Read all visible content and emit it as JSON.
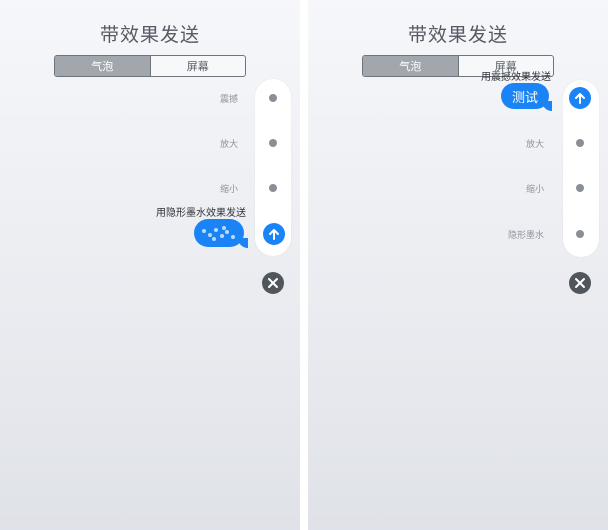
{
  "left": {
    "title": "带效果发送",
    "tabs": [
      {
        "label": "气泡",
        "active": true
      },
      {
        "label": "屏幕",
        "active": false
      }
    ],
    "effects": [
      {
        "label": "震撼"
      },
      {
        "label": "放大"
      },
      {
        "label": "缩小"
      }
    ],
    "selected_effect_caption": "用隐形墨水效果发送"
  },
  "right": {
    "title": "带效果发送",
    "tabs": [
      {
        "label": "气泡",
        "active": true
      },
      {
        "label": "屏幕",
        "active": false
      }
    ],
    "effects": [
      {
        "label": "放大"
      },
      {
        "label": "缩小"
      },
      {
        "label": "隐形墨水"
      }
    ],
    "selected_effect_caption": "用震撼效果发送",
    "bubble_text": "测试"
  },
  "colors": {
    "accent": "#1a84f6",
    "close": "#51565d",
    "panel_bg": "#eef0f4"
  },
  "icons": {
    "send": "arrow-up-icon",
    "close": "close-icon"
  }
}
